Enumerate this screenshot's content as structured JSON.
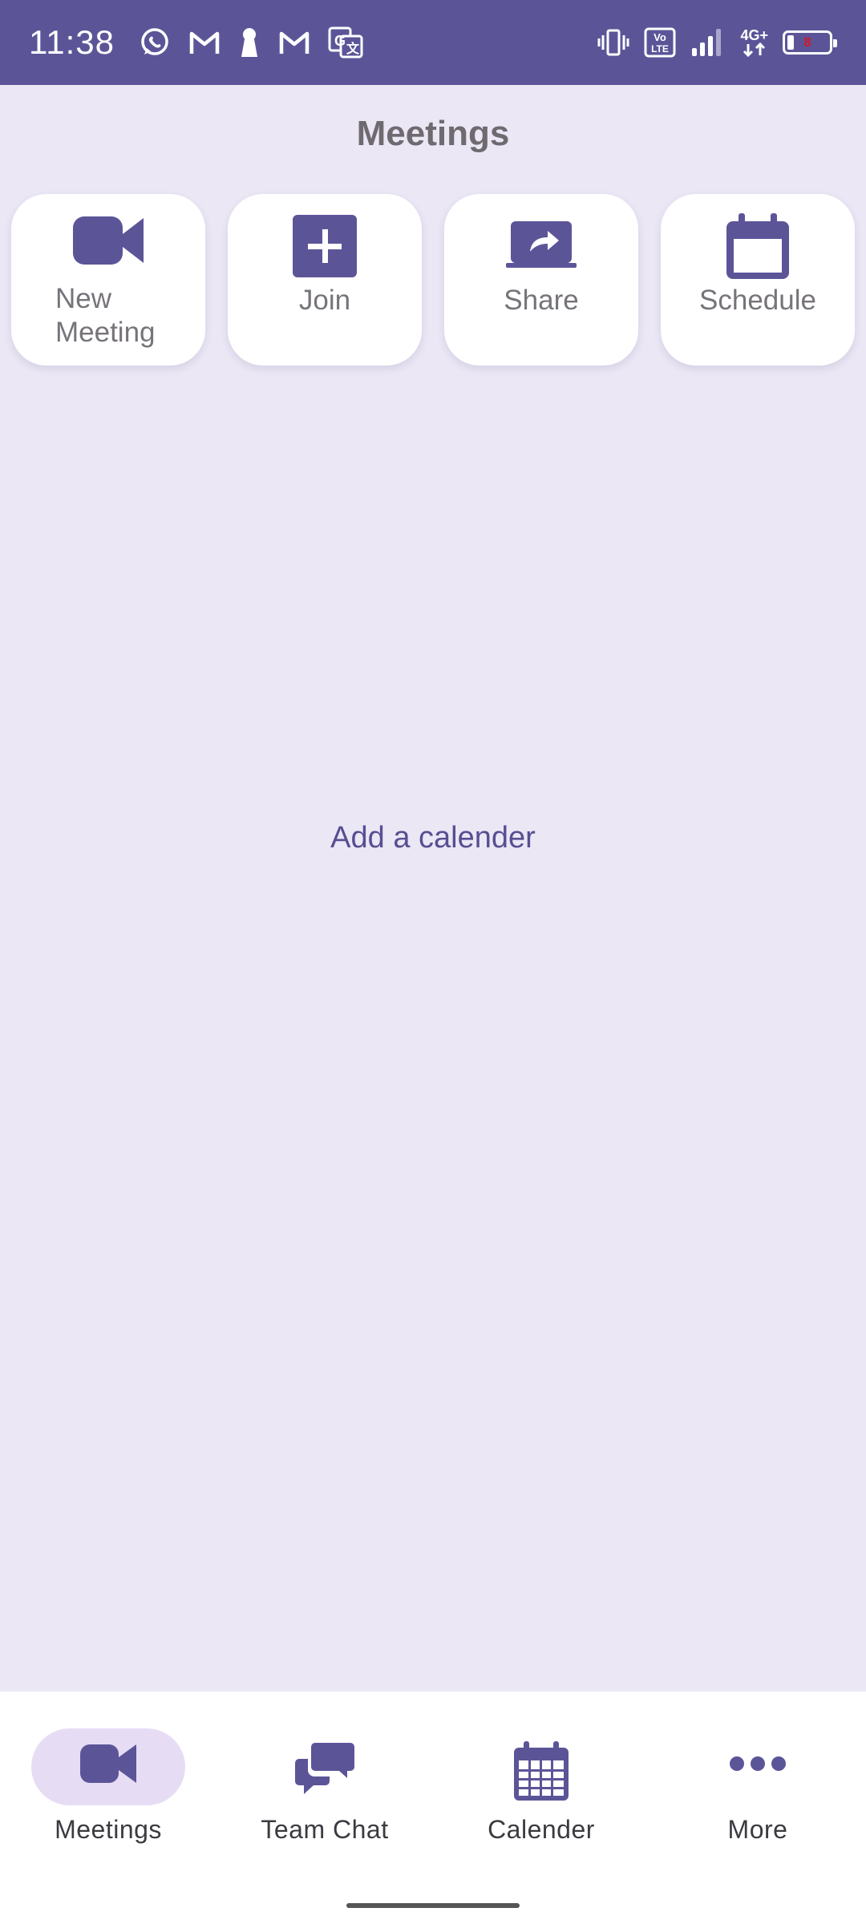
{
  "status_bar": {
    "time": "11:38",
    "network_label": "4G+",
    "volte_label": "Vo LTE",
    "battery_level": "8",
    "notification_icons": [
      "whatsapp-icon",
      "gmail-icon",
      "keyhole-icon",
      "gmail-icon",
      "translate-icon"
    ]
  },
  "header": {
    "title": "Meetings"
  },
  "actions": [
    {
      "label": "New Meeting",
      "icon": "video-camera-icon"
    },
    {
      "label": "Join",
      "icon": "plus-icon"
    },
    {
      "label": "Share",
      "icon": "share-screen-icon"
    },
    {
      "label": "Schedule",
      "icon": "calendar-icon"
    }
  ],
  "main": {
    "empty_state_text": "Add a calender"
  },
  "bottom_nav": {
    "items": [
      {
        "label": "Meetings",
        "icon": "video-camera-icon",
        "active": true
      },
      {
        "label": "Team Chat",
        "icon": "chat-bubbles-icon",
        "active": false
      },
      {
        "label": "Calender",
        "icon": "calendar-grid-icon",
        "active": false
      },
      {
        "label": "More",
        "icon": "more-dots-icon",
        "active": false
      }
    ]
  },
  "colors": {
    "accent": "#5b5598",
    "background": "#ebe7f5",
    "active_pill": "#e6ddf5",
    "link_text": "#574f92"
  }
}
